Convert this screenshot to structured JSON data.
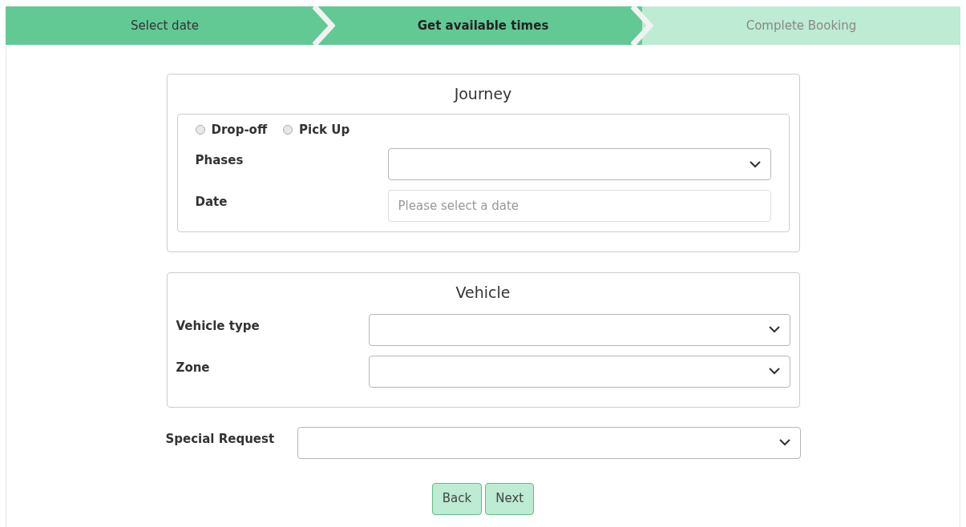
{
  "steps": [
    {
      "label": "Select date",
      "completed": true,
      "selected": false
    },
    {
      "label": "Get available times",
      "completed": true,
      "selected": true
    },
    {
      "label": "Complete Booking",
      "completed": false,
      "selected": false
    }
  ],
  "journey": {
    "title": "Journey",
    "options": [
      {
        "label": "Drop-off",
        "checked": false
      },
      {
        "label": "Pick Up",
        "checked": false
      }
    ],
    "fields": [
      {
        "kind": "select",
        "label": "Phases"
      },
      {
        "kind": "date",
        "label": "Date",
        "placeholder": "Please select a date"
      }
    ]
  },
  "vehicle": {
    "title": "Vehicle",
    "fields": [
      {
        "kind": "select",
        "label": "Vehicle type"
      },
      {
        "kind": "select",
        "label": "Zone"
      }
    ]
  },
  "special_request": {
    "kind": "select",
    "label": "Special Request"
  },
  "buttons": [
    "Back",
    "Next"
  ]
}
